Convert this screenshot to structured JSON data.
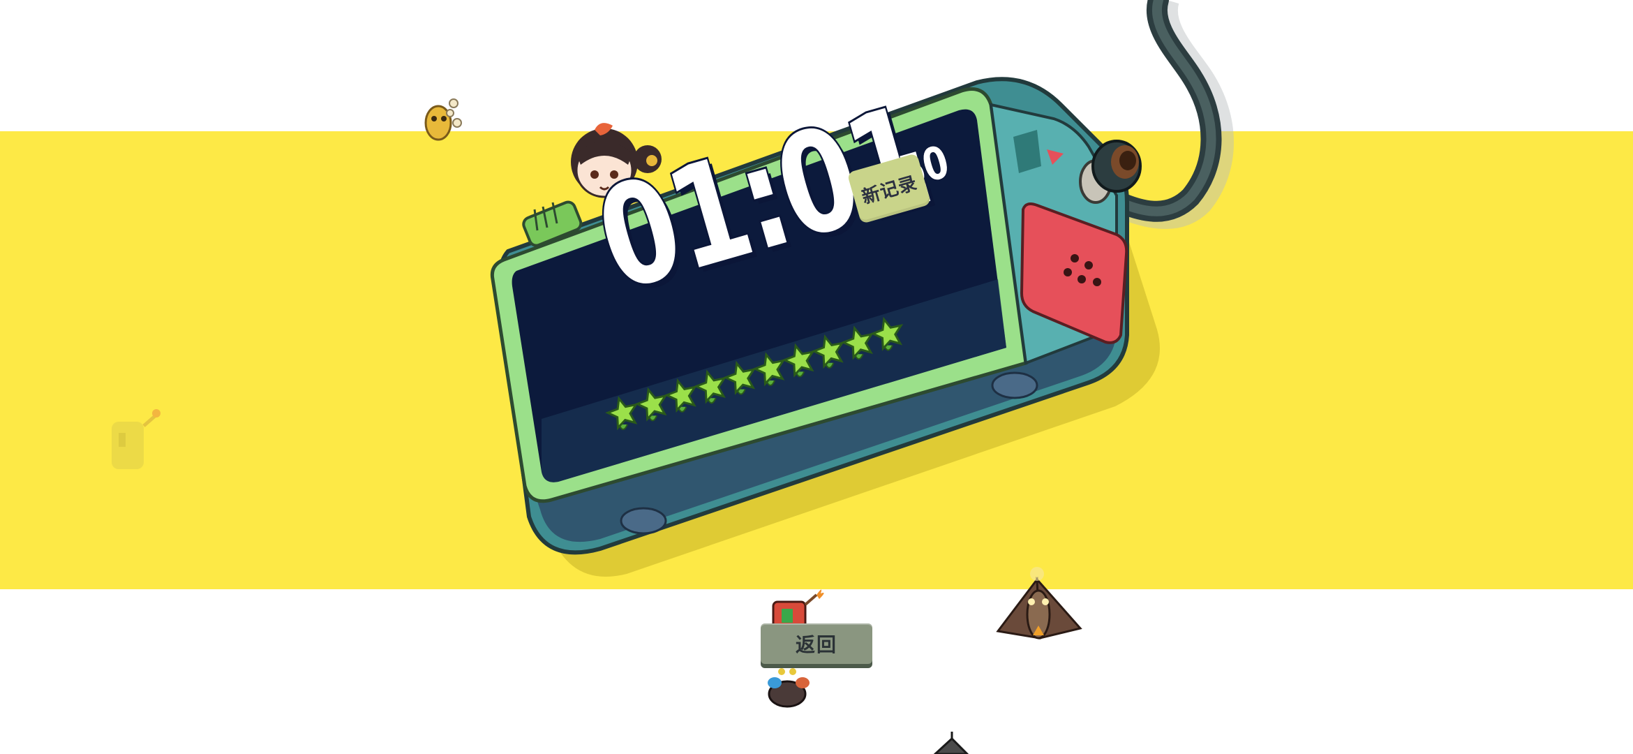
{
  "game": {
    "timer": {
      "main": "01:01",
      "fraction": ":50"
    },
    "new_record_label": "新记录",
    "back_button_label": "返回",
    "rating": {
      "stars_filled": 10,
      "stars_total": 10
    }
  },
  "colors": {
    "background": "#ffffff",
    "band": "#fde946",
    "device_body": "#4fa8a8",
    "device_rim": "#8fd88a",
    "screen": "#0b1638",
    "star": "#9be04a",
    "red_panel": "#e6505a",
    "button": "#8a9680"
  },
  "icons": {
    "character": "girl-character-icon",
    "stars": "green-star-icon",
    "enemies": [
      "small-yellow-enemy-icon",
      "faded-yellow-enemy-icon",
      "red-torch-enemy-icon",
      "brown-moth-enemy-icon",
      "dark-crab-enemy-icon",
      "helmet-enemy-icon"
    ]
  }
}
